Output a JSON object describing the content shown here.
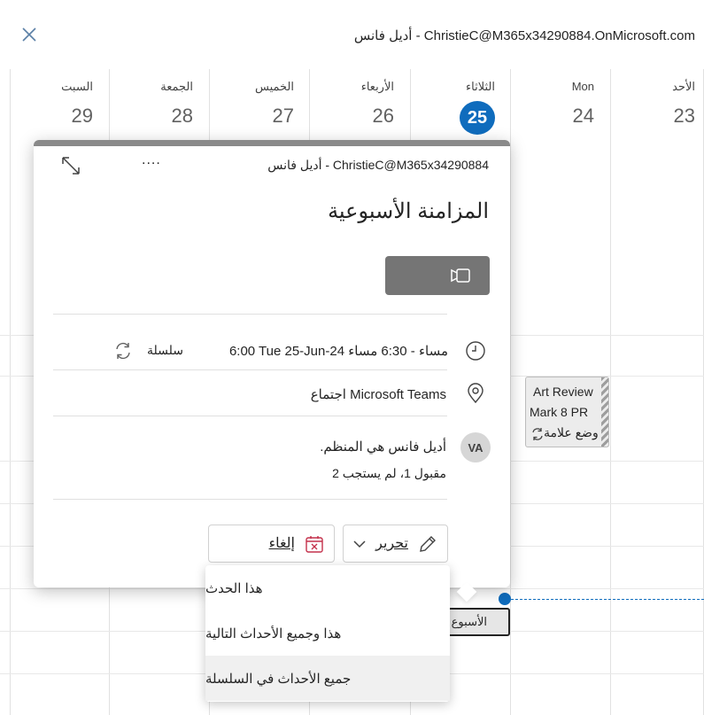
{
  "header": {
    "account": "أديل فانس - ChristieC@M365x34290884.OnMicrosoft.com"
  },
  "calendar": {
    "days": [
      {
        "name": "السبت",
        "num": "29"
      },
      {
        "name": "الجمعة",
        "num": "28"
      },
      {
        "name": "الخميس",
        "num": "27"
      },
      {
        "name": "الأربعاء",
        "num": "26"
      },
      {
        "name": "الثلاثاء",
        "num": "25"
      },
      {
        "name": "Mon",
        "num": "24"
      },
      {
        "name": "الأحد",
        "num": "23"
      }
    ],
    "events": {
      "art_review": {
        "line1": "Art Review",
        "line2": "Mark 8 PR",
        "line3": "وضع علامة"
      },
      "weekly": "الأسبوع ال"
    }
  },
  "popup": {
    "organizer_line": "أديل فانس - ChristieC@M365x34290884",
    "more": "....",
    "title": "المزامنة الأسبوعية",
    "time": "6:00 Tue 25-Jun-24 مساء - 6:30 مساء",
    "series": "سلسلة",
    "location": "اجتماع Microsoft Teams",
    "avatar_initials": "VA",
    "organizer_text": "أديل فانس هي المنظم.",
    "responses": "مقبول 1، لم يستجب 2",
    "edit_label": "تحرير",
    "cancel_label": "إلغاء"
  },
  "menu": {
    "items": [
      "هذا الحدث",
      "هذا وجميع الأحداث التالية",
      "جميع الأحداث في السلسلة"
    ]
  },
  "colors": {
    "accent": "#0f6cbd",
    "join_button": "#757575",
    "cancel_icon": "#c4314b"
  }
}
